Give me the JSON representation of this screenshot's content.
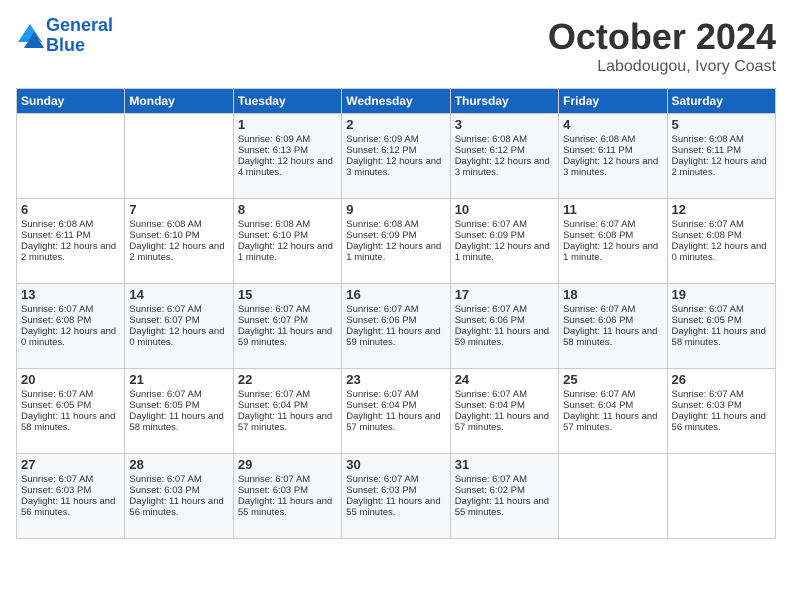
{
  "header": {
    "logo_line1": "General",
    "logo_line2": "Blue",
    "month": "October 2024",
    "location": "Labodougou, Ivory Coast"
  },
  "weekdays": [
    "Sunday",
    "Monday",
    "Tuesday",
    "Wednesday",
    "Thursday",
    "Friday",
    "Saturday"
  ],
  "weeks": [
    [
      {
        "day": "",
        "sunrise": "",
        "sunset": "",
        "daylight": ""
      },
      {
        "day": "",
        "sunrise": "",
        "sunset": "",
        "daylight": ""
      },
      {
        "day": "1",
        "sunrise": "Sunrise: 6:09 AM",
        "sunset": "Sunset: 6:13 PM",
        "daylight": "Daylight: 12 hours and 4 minutes."
      },
      {
        "day": "2",
        "sunrise": "Sunrise: 6:09 AM",
        "sunset": "Sunset: 6:12 PM",
        "daylight": "Daylight: 12 hours and 3 minutes."
      },
      {
        "day": "3",
        "sunrise": "Sunrise: 6:08 AM",
        "sunset": "Sunset: 6:12 PM",
        "daylight": "Daylight: 12 hours and 3 minutes."
      },
      {
        "day": "4",
        "sunrise": "Sunrise: 6:08 AM",
        "sunset": "Sunset: 6:11 PM",
        "daylight": "Daylight: 12 hours and 3 minutes."
      },
      {
        "day": "5",
        "sunrise": "Sunrise: 6:08 AM",
        "sunset": "Sunset: 6:11 PM",
        "daylight": "Daylight: 12 hours and 2 minutes."
      }
    ],
    [
      {
        "day": "6",
        "sunrise": "Sunrise: 6:08 AM",
        "sunset": "Sunset: 6:11 PM",
        "daylight": "Daylight: 12 hours and 2 minutes."
      },
      {
        "day": "7",
        "sunrise": "Sunrise: 6:08 AM",
        "sunset": "Sunset: 6:10 PM",
        "daylight": "Daylight: 12 hours and 2 minutes."
      },
      {
        "day": "8",
        "sunrise": "Sunrise: 6:08 AM",
        "sunset": "Sunset: 6:10 PM",
        "daylight": "Daylight: 12 hours and 1 minute."
      },
      {
        "day": "9",
        "sunrise": "Sunrise: 6:08 AM",
        "sunset": "Sunset: 6:09 PM",
        "daylight": "Daylight: 12 hours and 1 minute."
      },
      {
        "day": "10",
        "sunrise": "Sunrise: 6:07 AM",
        "sunset": "Sunset: 6:09 PM",
        "daylight": "Daylight: 12 hours and 1 minute."
      },
      {
        "day": "11",
        "sunrise": "Sunrise: 6:07 AM",
        "sunset": "Sunset: 6:08 PM",
        "daylight": "Daylight: 12 hours and 1 minute."
      },
      {
        "day": "12",
        "sunrise": "Sunrise: 6:07 AM",
        "sunset": "Sunset: 6:08 PM",
        "daylight": "Daylight: 12 hours and 0 minutes."
      }
    ],
    [
      {
        "day": "13",
        "sunrise": "Sunrise: 6:07 AM",
        "sunset": "Sunset: 6:08 PM",
        "daylight": "Daylight: 12 hours and 0 minutes."
      },
      {
        "day": "14",
        "sunrise": "Sunrise: 6:07 AM",
        "sunset": "Sunset: 6:07 PM",
        "daylight": "Daylight: 12 hours and 0 minutes."
      },
      {
        "day": "15",
        "sunrise": "Sunrise: 6:07 AM",
        "sunset": "Sunset: 6:07 PM",
        "daylight": "Daylight: 11 hours and 59 minutes."
      },
      {
        "day": "16",
        "sunrise": "Sunrise: 6:07 AM",
        "sunset": "Sunset: 6:06 PM",
        "daylight": "Daylight: 11 hours and 59 minutes."
      },
      {
        "day": "17",
        "sunrise": "Sunrise: 6:07 AM",
        "sunset": "Sunset: 6:06 PM",
        "daylight": "Daylight: 11 hours and 59 minutes."
      },
      {
        "day": "18",
        "sunrise": "Sunrise: 6:07 AM",
        "sunset": "Sunset: 6:06 PM",
        "daylight": "Daylight: 11 hours and 58 minutes."
      },
      {
        "day": "19",
        "sunrise": "Sunrise: 6:07 AM",
        "sunset": "Sunset: 6:05 PM",
        "daylight": "Daylight: 11 hours and 58 minutes."
      }
    ],
    [
      {
        "day": "20",
        "sunrise": "Sunrise: 6:07 AM",
        "sunset": "Sunset: 6:05 PM",
        "daylight": "Daylight: 11 hours and 58 minutes."
      },
      {
        "day": "21",
        "sunrise": "Sunrise: 6:07 AM",
        "sunset": "Sunset: 6:05 PM",
        "daylight": "Daylight: 11 hours and 58 minutes."
      },
      {
        "day": "22",
        "sunrise": "Sunrise: 6:07 AM",
        "sunset": "Sunset: 6:04 PM",
        "daylight": "Daylight: 11 hours and 57 minutes."
      },
      {
        "day": "23",
        "sunrise": "Sunrise: 6:07 AM",
        "sunset": "Sunset: 6:04 PM",
        "daylight": "Daylight: 11 hours and 57 minutes."
      },
      {
        "day": "24",
        "sunrise": "Sunrise: 6:07 AM",
        "sunset": "Sunset: 6:04 PM",
        "daylight": "Daylight: 11 hours and 57 minutes."
      },
      {
        "day": "25",
        "sunrise": "Sunrise: 6:07 AM",
        "sunset": "Sunset: 6:04 PM",
        "daylight": "Daylight: 11 hours and 57 minutes."
      },
      {
        "day": "26",
        "sunrise": "Sunrise: 6:07 AM",
        "sunset": "Sunset: 6:03 PM",
        "daylight": "Daylight: 11 hours and 56 minutes."
      }
    ],
    [
      {
        "day": "27",
        "sunrise": "Sunrise: 6:07 AM",
        "sunset": "Sunset: 6:03 PM",
        "daylight": "Daylight: 11 hours and 56 minutes."
      },
      {
        "day": "28",
        "sunrise": "Sunrise: 6:07 AM",
        "sunset": "Sunset: 6:03 PM",
        "daylight": "Daylight: 11 hours and 56 minutes."
      },
      {
        "day": "29",
        "sunrise": "Sunrise: 6:07 AM",
        "sunset": "Sunset: 6:03 PM",
        "daylight": "Daylight: 11 hours and 55 minutes."
      },
      {
        "day": "30",
        "sunrise": "Sunrise: 6:07 AM",
        "sunset": "Sunset: 6:03 PM",
        "daylight": "Daylight: 11 hours and 55 minutes."
      },
      {
        "day": "31",
        "sunrise": "Sunrise: 6:07 AM",
        "sunset": "Sunset: 6:02 PM",
        "daylight": "Daylight: 11 hours and 55 minutes."
      },
      {
        "day": "",
        "sunrise": "",
        "sunset": "",
        "daylight": ""
      },
      {
        "day": "",
        "sunrise": "",
        "sunset": "",
        "daylight": ""
      }
    ]
  ]
}
